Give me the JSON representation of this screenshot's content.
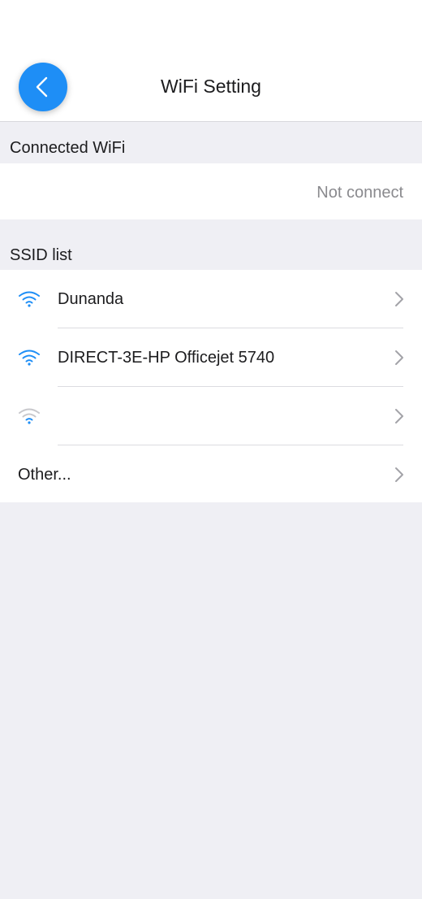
{
  "nav": {
    "title": "WiFi Setting",
    "back_icon": "chevron-left-icon",
    "accent_color": "#1e8ef6"
  },
  "connected": {
    "header": "Connected WiFi",
    "status": "Not connect"
  },
  "ssid_list": {
    "header": "SSID list",
    "networks": [
      {
        "ssid": "Dunanda",
        "icon": "wifi-icon",
        "signal": "strong"
      },
      {
        "ssid": "DIRECT-3E-HP Officejet 5740",
        "icon": "wifi-icon",
        "signal": "strong"
      },
      {
        "ssid": "",
        "icon": "wifi-icon",
        "signal": "weak"
      }
    ],
    "other_label": "Other..."
  }
}
